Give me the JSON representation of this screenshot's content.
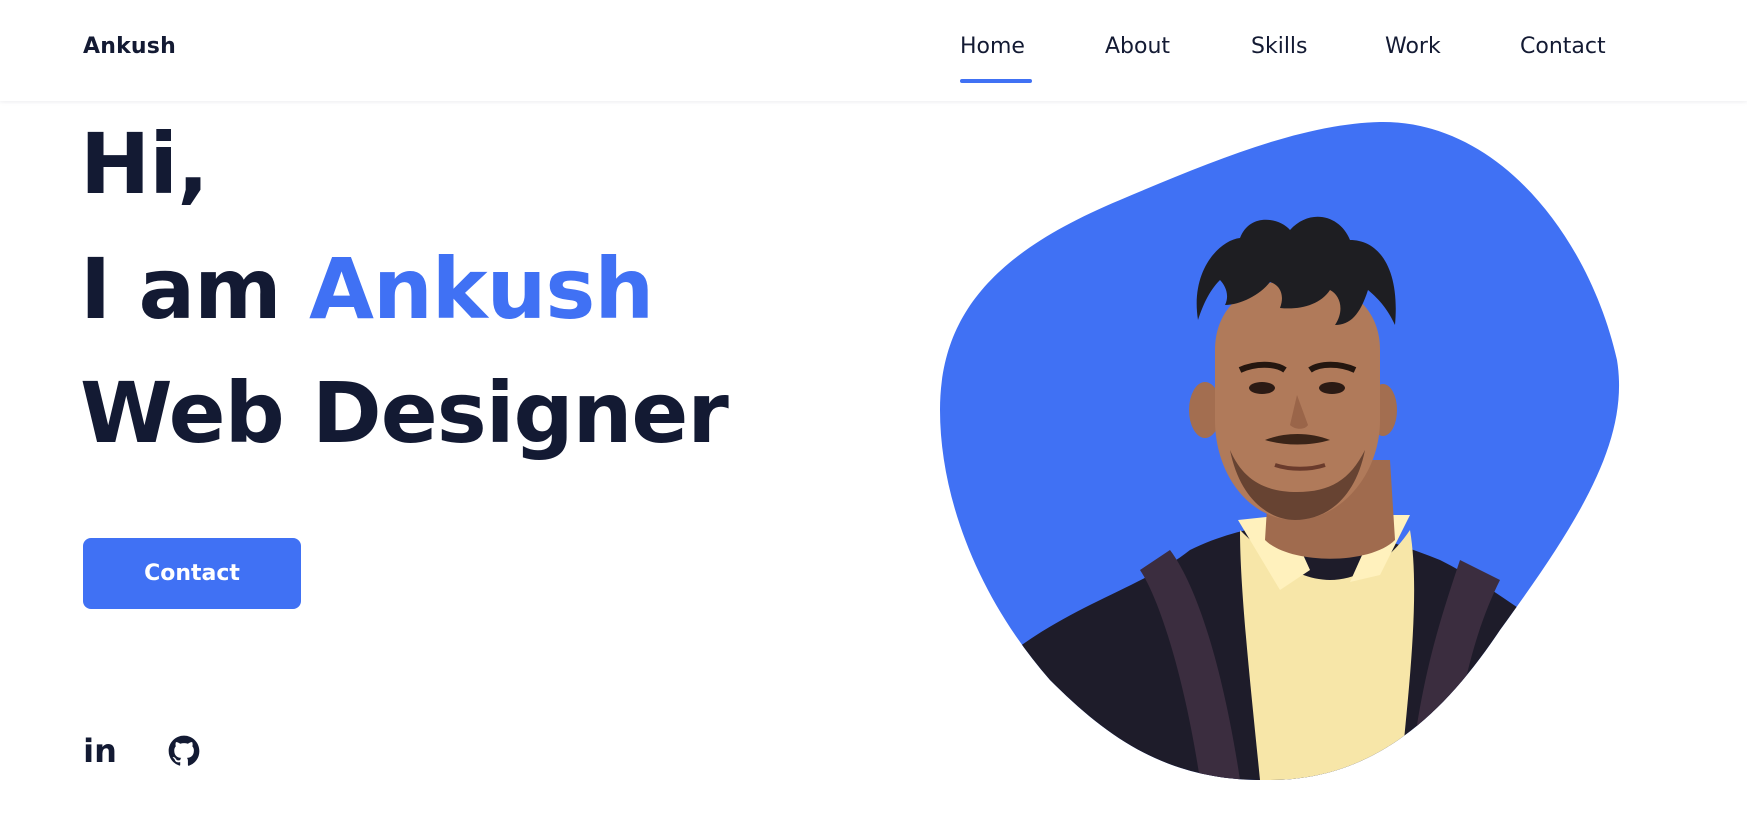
{
  "header": {
    "brand": "Ankush",
    "nav": [
      {
        "label": "Home",
        "active": true
      },
      {
        "label": "About"
      },
      {
        "label": "Skills"
      },
      {
        "label": "Work"
      },
      {
        "label": "Contact"
      }
    ]
  },
  "hero": {
    "line1": "Hi,",
    "line2_prefix": "I am ",
    "line2_name": "Ankush",
    "line3": "Web Designer",
    "button": "Contact"
  },
  "social": {
    "linkedin_text": "in",
    "icons": [
      "linkedin-icon",
      "github-icon"
    ]
  },
  "colors": {
    "accent": "#4071f4",
    "text": "#131a33",
    "background": "#ffffff"
  },
  "image": {
    "subject": "portrait photo of a young man in a dark jacket and yellow shirt"
  }
}
